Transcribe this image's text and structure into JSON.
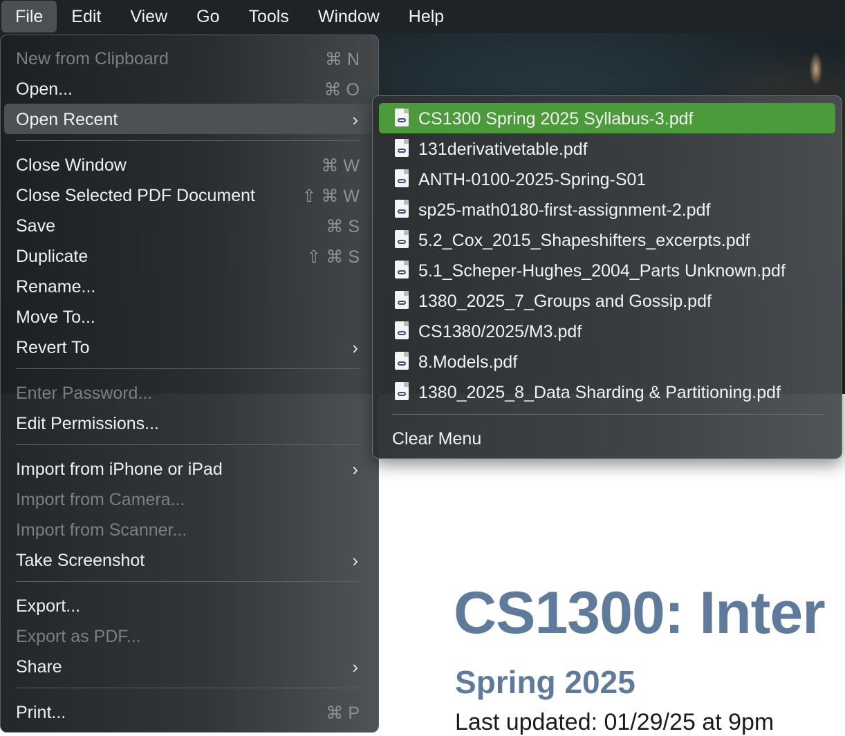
{
  "menubar": {
    "items": [
      "File",
      "Edit",
      "View",
      "Go",
      "Tools",
      "Window",
      "Help"
    ]
  },
  "file_menu": {
    "items": [
      {
        "label": "New from Clipboard",
        "shortcut": "⌘ N",
        "disabled": true
      },
      {
        "label": "Open...",
        "shortcut": "⌘ O"
      },
      {
        "label": "Open Recent",
        "submenu": true,
        "highlighted": true
      },
      {
        "label": "Close Window",
        "shortcut": "⌘ W"
      },
      {
        "label": "Close Selected PDF Document",
        "shortcut": "⇧ ⌘ W"
      },
      {
        "label": "Save",
        "shortcut": "⌘ S"
      },
      {
        "label": "Duplicate",
        "shortcut": "⇧ ⌘ S"
      },
      {
        "label": "Rename..."
      },
      {
        "label": "Move To..."
      },
      {
        "label": "Revert To",
        "submenu": true
      },
      {
        "label": "Enter Password...",
        "disabled": true
      },
      {
        "label": "Edit Permissions..."
      },
      {
        "label": "Import from iPhone or iPad",
        "submenu": true
      },
      {
        "label": "Import from Camera...",
        "disabled": true
      },
      {
        "label": "Import from Scanner...",
        "disabled": true
      },
      {
        "label": "Take Screenshot",
        "submenu": true
      },
      {
        "label": "Export..."
      },
      {
        "label": "Export as PDF...",
        "disabled": true
      },
      {
        "label": "Share",
        "submenu": true
      },
      {
        "label": "Print...",
        "shortcut": "⌘ P"
      }
    ]
  },
  "open_recent": {
    "files": [
      "CS1300 Spring 2025 Syllabus-3.pdf",
      "131derivativetable.pdf",
      "ANTH-0100-2025-Spring-S01",
      "sp25-math0180-first-assignment-2.pdf",
      "5.2_Cox_2015_Shapeshifters_excerpts.pdf",
      "5.1_Scheper-Hughes_2004_Parts Unknown.pdf",
      "1380_2025_7_Groups and Gossip.pdf",
      "CS1380/2025/M3.pdf",
      "8.Models.pdf",
      "1380_2025_8_Data Sharding & Partitioning.pdf"
    ],
    "clear_label": "Clear Menu"
  },
  "document": {
    "title": "CS1300: Inter",
    "subtitle": "Spring 2025",
    "updated": "Last updated: 01/29/25 at 9pm"
  },
  "colors": {
    "highlight_green": "#4c9b3b",
    "title_blue": "#5f7b9b"
  }
}
